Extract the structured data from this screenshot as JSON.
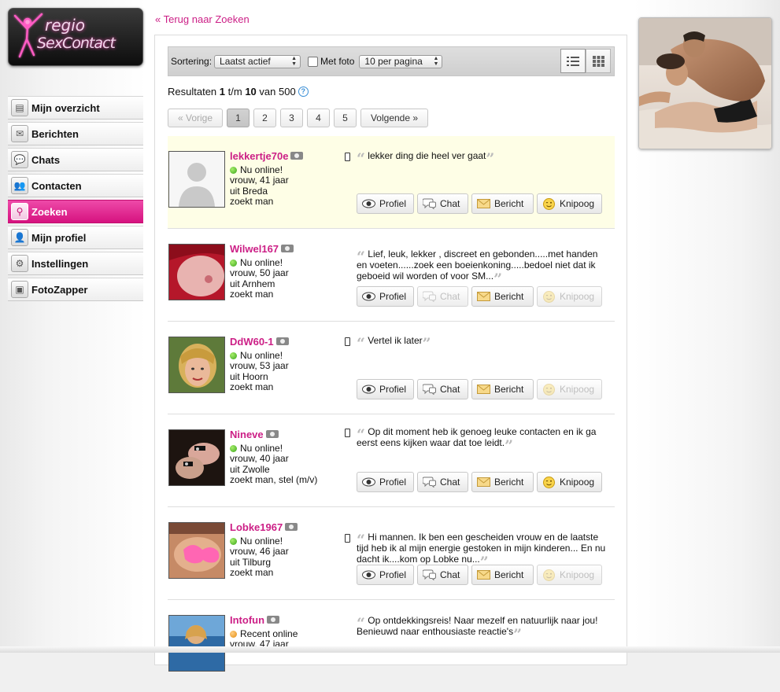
{
  "logo": {
    "line1": "regio",
    "line2": "SexContact"
  },
  "nav": [
    {
      "label": "Mijn overzicht",
      "icon": "person-card-icon",
      "glyph": "▤",
      "active": false
    },
    {
      "label": "Berichten",
      "icon": "envelope-icon",
      "glyph": "✉",
      "active": false
    },
    {
      "label": "Chats",
      "icon": "chat-bubble-icon",
      "glyph": "💬",
      "active": false
    },
    {
      "label": "Contacten",
      "icon": "contacts-icon",
      "glyph": "👥",
      "active": false
    },
    {
      "label": "Zoeken",
      "icon": "magnifier-icon",
      "glyph": "⚲",
      "active": true
    },
    {
      "label": "Mijn profiel",
      "icon": "user-icon",
      "glyph": "👤",
      "active": false
    },
    {
      "label": "Instellingen",
      "icon": "gear-icon",
      "glyph": "⚙",
      "active": false
    },
    {
      "label": "FotoZapper",
      "icon": "tv-icon",
      "glyph": "▣",
      "active": false
    }
  ],
  "back_link": "« Terug naar Zoeken",
  "toolbar": {
    "sort_label": "Sortering:",
    "sort_value": "Laatst actief",
    "photo_label": "Met foto",
    "per_page_value": "10 per pagina"
  },
  "results": {
    "prefix": "Resultaten",
    "from": "1",
    "sep": "t/m",
    "to": "10",
    "of": "van",
    "total": "500",
    "help": "?"
  },
  "pager": {
    "prev": "« Vorige",
    "pages": [
      "1",
      "2",
      "3",
      "4",
      "5"
    ],
    "current": "1",
    "next": "Volgende »"
  },
  "actions": {
    "profile": "Profiel",
    "chat": "Chat",
    "message": "Bericht",
    "wink": "Knipoog"
  },
  "profiles": [
    {
      "name": "lekkertje70e",
      "status": "Nu online!",
      "status_color": "green",
      "line1": "vrouw, 41 jaar",
      "line2": "uit Breda",
      "line3": "zoekt man",
      "quote": "lekker ding die heel ver gaat",
      "mobile": true,
      "chat_enabled": true,
      "wink_enabled": true,
      "highlight": true,
      "photo": "placeholder"
    },
    {
      "name": "Wilwel167",
      "status": "Nu online!",
      "status_color": "green",
      "line1": "vrouw, 50 jaar",
      "line2": "uit Arnhem",
      "line3": "zoekt man",
      "quote": "Lief, leuk, lekker , discreet en gebonden.....met handen en voeten......zoek een boeienkoning.....bedoel niet dat ik geboeid wil worden of voor SM...",
      "mobile": false,
      "chat_enabled": false,
      "wink_enabled": false,
      "highlight": false,
      "photo": "red"
    },
    {
      "name": "DdW60-1",
      "status": "Nu online!",
      "status_color": "green",
      "line1": "vrouw, 53 jaar",
      "line2": "uit Hoorn",
      "line3": "zoekt man",
      "quote": "Vertel ik later",
      "mobile": true,
      "chat_enabled": true,
      "wink_enabled": false,
      "highlight": false,
      "photo": "blond"
    },
    {
      "name": "Nineve",
      "status": "Nu online!",
      "status_color": "green",
      "line1": "vrouw, 40 jaar",
      "line2": "uit Zwolle",
      "line3": "zoekt man, stel (m/v)",
      "quote": "Op dit moment heb ik genoeg leuke contacten en ik ga eerst eens kijken waar dat toe leidt.",
      "mobile": true,
      "chat_enabled": true,
      "wink_enabled": true,
      "highlight": false,
      "photo": "dark"
    },
    {
      "name": "Lobke1967",
      "status": "Nu online!",
      "status_color": "green",
      "line1": "vrouw, 46 jaar",
      "line2": "uit Tilburg",
      "line3": "zoekt man",
      "quote": "Hi mannen. Ik ben een gescheiden vrouw en de laatste tijd heb ik al mijn energie gestoken in mijn kinderen... En nu dacht ik....kom op Lobke nu...",
      "mobile": true,
      "chat_enabled": true,
      "wink_enabled": false,
      "highlight": false,
      "photo": "pink"
    },
    {
      "name": "Intofun",
      "status": "Recent online",
      "status_color": "orange",
      "line1": "vrouw, 47 jaar",
      "line2": "",
      "line3": "",
      "quote": "Op ontdekkingsreis! Naar mezelf en natuurlijk naar jou! Benieuwd naar enthousiaste reactie's",
      "mobile": false,
      "chat_enabled": true,
      "wink_enabled": true,
      "highlight": false,
      "photo": "sea"
    }
  ],
  "colors": {
    "brand_pink": "#cc1f86",
    "online_green": "#3aa51b",
    "recent_orange": "#e58c10",
    "highlight_bg": "#fefee6"
  }
}
